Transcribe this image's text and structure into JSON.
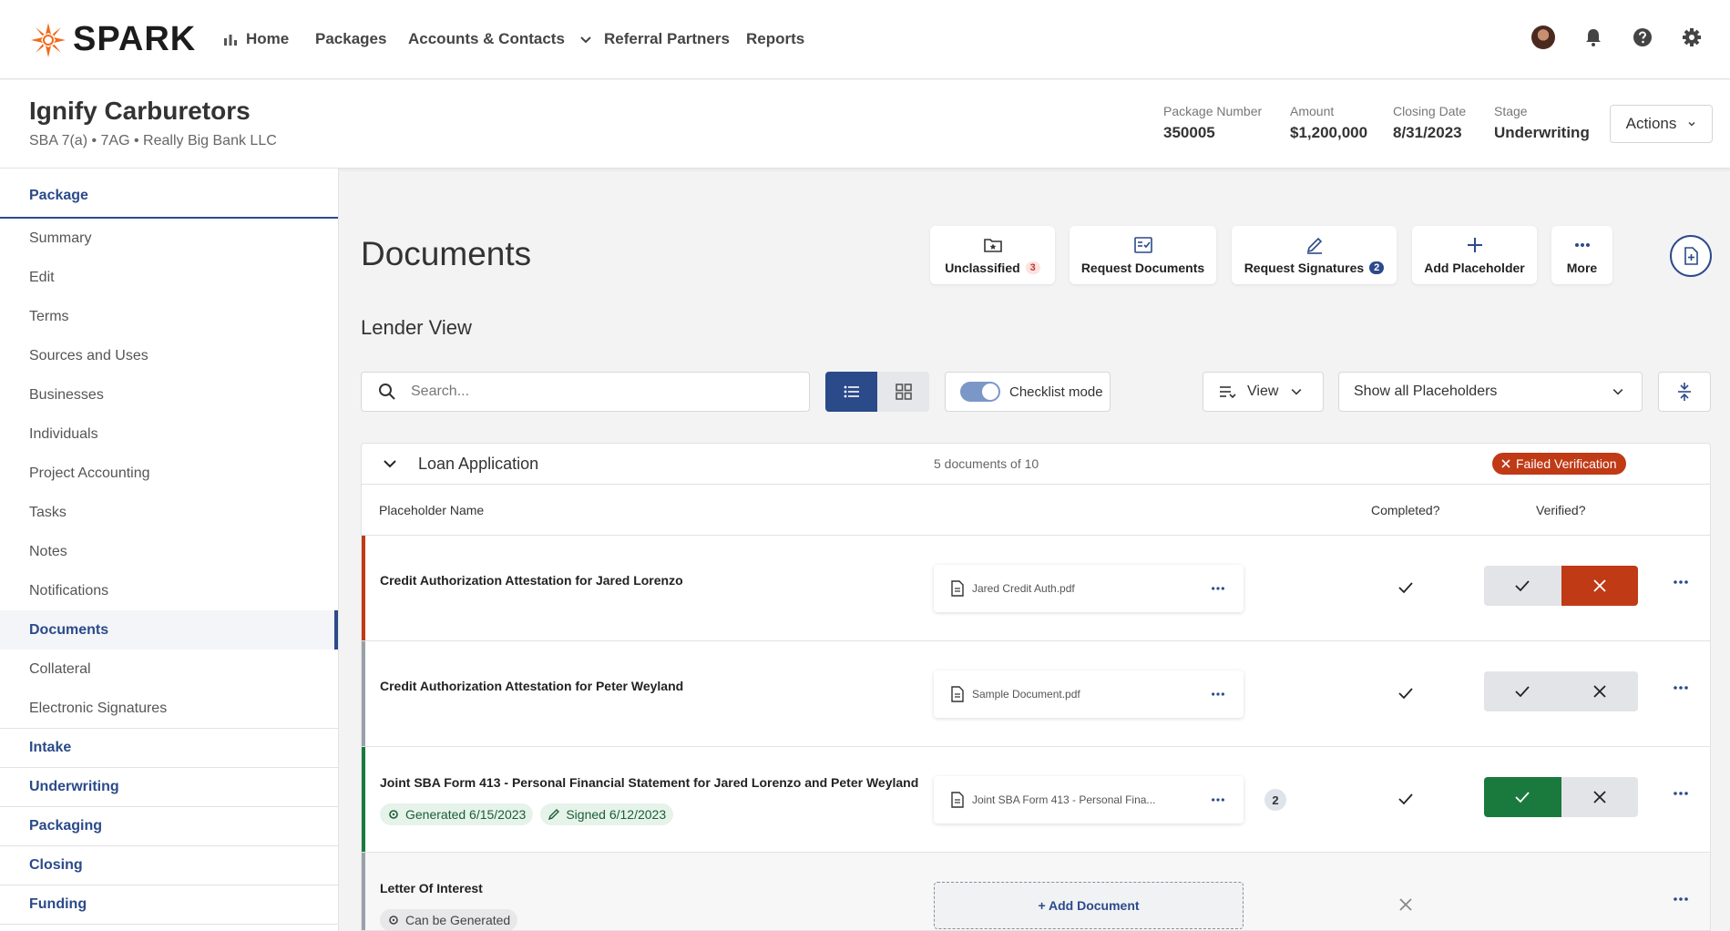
{
  "brand": {
    "name": "SPARK",
    "accent": "#f26a1b",
    "primary": "#2b4a8a"
  },
  "nav": {
    "home": "Home",
    "packages": "Packages",
    "accounts": "Accounts & Contacts",
    "referral": "Referral Partners",
    "reports": "Reports"
  },
  "package": {
    "title": "Ignify Carburetors",
    "subtitle": "SBA 7(a) • 7AG • Really Big Bank LLC",
    "stats": [
      {
        "label": "Package Number",
        "value": "350005"
      },
      {
        "label": "Amount",
        "value": "$1,200,000"
      },
      {
        "label": "Closing Date",
        "value": "8/31/2023"
      },
      {
        "label": "Stage",
        "value": "Underwriting"
      }
    ],
    "actions_label": "Actions"
  },
  "sidebar": {
    "package_header": "Package",
    "items": [
      "Summary",
      "Edit",
      "Terms",
      "Sources and Uses",
      "Businesses",
      "Individuals",
      "Project Accounting",
      "Tasks",
      "Notes",
      "Notifications",
      "Documents",
      "Collateral",
      "Electronic Signatures"
    ],
    "active_item": "Documents",
    "sections": [
      "Intake",
      "Underwriting",
      "Packaging",
      "Closing",
      "Funding"
    ]
  },
  "main": {
    "title": "Documents",
    "quick_actions": {
      "unclassified": "Unclassified",
      "unclassified_count": "3",
      "request_documents": "Request Documents",
      "request_signatures": "Request Signatures",
      "request_signatures_count": "2",
      "add_placeholder": "Add Placeholder",
      "more": "More"
    },
    "view_name": "Lender View",
    "search_placeholder": "Search...",
    "checklist_mode": "Checklist mode",
    "view_label": "View",
    "placeholder_filter": "Show all Placeholders"
  },
  "table": {
    "group": {
      "name": "Loan Application",
      "count": "5 documents of 10",
      "status": "Failed Verification"
    },
    "headers": {
      "placeholder": "Placeholder Name",
      "completed": "Completed?",
      "verified": "Verified?"
    },
    "rows": [
      {
        "name": "Credit Authorization Attestation for Jared Lorenzo",
        "file": "Jared Credit Auth.pdf",
        "verified": "rejected"
      },
      {
        "name": "Credit Authorization Attestation for Peter Weyland",
        "file": "Sample Document.pdf",
        "verified": "none"
      },
      {
        "name": "Joint SBA Form 413 - Personal Financial Statement for Jared Lorenzo and Peter Weyland",
        "file": "Joint SBA Form 413 - Personal Fina...",
        "extra_count": "2",
        "generated": "Generated 6/15/2023",
        "signed": "Signed 6/12/2023",
        "verified": "approved"
      },
      {
        "name": "Letter Of Interest",
        "chip": "Can be Generated",
        "add_label": "+ Add Document"
      }
    ]
  },
  "icons": [
    "spark-logo-icon",
    "bar-chart-icon",
    "chevron-down-icon",
    "bell-icon",
    "help-icon",
    "gear-icon",
    "folder-star-icon",
    "checklist-icon",
    "pen-icon",
    "plus-icon",
    "more-dots-icon",
    "add-file-icon",
    "search-icon",
    "list-icon",
    "grid-icon",
    "filter-lines-icon",
    "collapse-icon",
    "file-icon",
    "check-icon",
    "close-icon"
  ]
}
